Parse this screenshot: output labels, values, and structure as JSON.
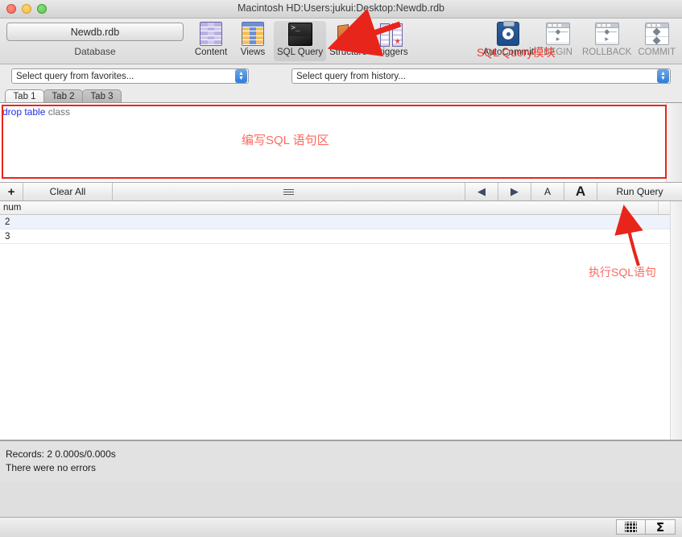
{
  "window": {
    "title": "Macintosh HD:Users:jukui:Desktop:Newdb.rdb",
    "traffic": {
      "close": "close-button",
      "minimize": "minimize-button",
      "maximize": "maximize-button"
    }
  },
  "toolbar": {
    "database_button": "Newdb.rdb",
    "database_label": "Database",
    "items": [
      {
        "label": "Content",
        "icon": "table-grid-purple-icon",
        "selected": false,
        "enabled": true
      },
      {
        "label": "Views",
        "icon": "table-grid-blue-icon",
        "selected": false,
        "enabled": true
      },
      {
        "label": "SQL Query",
        "icon": "terminal-icon",
        "selected": true,
        "enabled": true
      },
      {
        "label": "Structure",
        "icon": "door-structure-icon",
        "selected": false,
        "enabled": true
      },
      {
        "label": "Triggers",
        "icon": "triggers-icon",
        "selected": false,
        "enabled": true
      }
    ],
    "right_items": [
      {
        "label": "AutoCommit",
        "icon": "clipboard-gear-icon",
        "enabled": true
      },
      {
        "label": "BEGIN",
        "icon": "transaction-begin-icon",
        "enabled": false
      },
      {
        "label": "ROLLBACK",
        "icon": "transaction-rollback-icon",
        "enabled": false
      },
      {
        "label": "COMMIT",
        "icon": "transaction-commit-icon",
        "enabled": false
      }
    ]
  },
  "selectors": {
    "favorites": "Select query from favorites...",
    "history": "Select query from history..."
  },
  "tabs": [
    {
      "label": "Tab 1",
      "active": true
    },
    {
      "label": "Tab 2",
      "active": false
    },
    {
      "label": "Tab 3",
      "active": false
    }
  ],
  "editor": {
    "sql_keyword": "drop table",
    "sql_identifier": "class"
  },
  "query_toolbar": {
    "add": "+",
    "clear_all": "Clear All",
    "menu_icon": "hamburger-menu-icon",
    "prev_icon": "arrow-left-icon",
    "next_icon": "arrow-right-icon",
    "font_smaller": "A",
    "font_larger": "A",
    "run_query": "Run Query"
  },
  "results": {
    "columns": [
      "num"
    ],
    "rows": [
      [
        "2"
      ],
      [
        "3"
      ]
    ]
  },
  "annotations": [
    {
      "text": "SQL Query模块",
      "color": "#f4362b",
      "name": "annotation-sql-query-module"
    },
    {
      "text": "编写SQL 语句区",
      "color": "#fb6a60",
      "name": "annotation-editor-area"
    },
    {
      "text": "执行SQL语句",
      "color": "#fb6a60",
      "name": "annotation-run-query"
    }
  ],
  "status": {
    "records": "Records: 2   0.000s/0.000s",
    "errors": "There were no errors"
  },
  "footer": {
    "table_view_icon": "table-view-icon",
    "aggregate_icon": "sigma-aggregate-icon"
  },
  "colors": {
    "annotation_red": "#f4362b",
    "annotation_pink": "#fb6a60",
    "sql_keyword": "#1d31e0",
    "sql_identifier": "#6f6f6f",
    "selected_row": "#eef2fb"
  }
}
